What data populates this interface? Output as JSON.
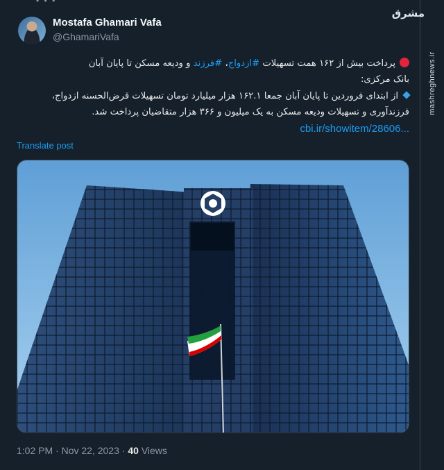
{
  "tweet": {
    "author_name": "Mostafa Ghamari Vafa",
    "author_handle": "@GhamariVafa",
    "text_lines": [
      {
        "before": "پرداخت بیش از ۱۶۲ همت تسهیلات ",
        "tag1": "#ازدواج",
        "mid": "، ",
        "tag2": "#فرزند",
        "after": " و ودیعه مسکن تا پایان آبان"
      },
      "بانک مرکزی:",
      "از ابتدای فروردین تا پایان آبان جمعا ۱۶۲.۱ هزار میلیارد تومان تسهیلات قرض‌الحسنه ازدواج،",
      "فرزندآوری و تسهیلات ودیعه مسکن به یک میلیون و ۳۶۶ هزار  متقاضیان پرداخت شد."
    ],
    "link": "cbi.ir/showitem/28606...",
    "translate_label": "Translate post",
    "time": "1:02 PM",
    "date": "Nov 22, 2023",
    "views_count": "40",
    "views_label": "Views"
  },
  "overlay": {
    "logo_text": "مشرق",
    "side_watermark": "mashreghnews.ir"
  },
  "colors": {
    "background": "#15202b",
    "link": "#1d9bf0",
    "muted": "#8b98a5"
  }
}
